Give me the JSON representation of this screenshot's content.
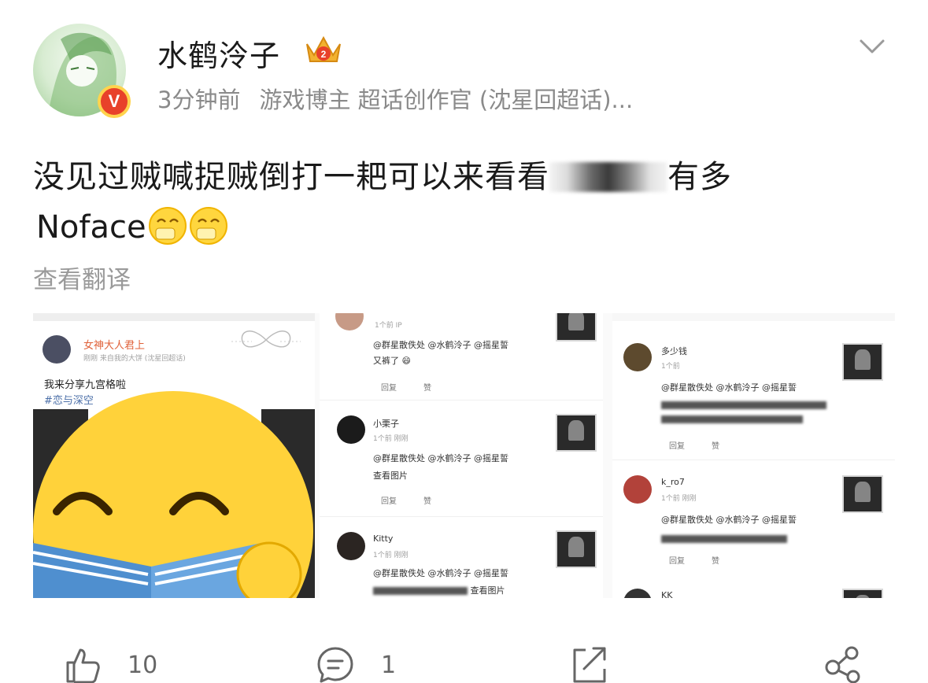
{
  "post": {
    "username": "水鹤泠子",
    "verified_badge": "V",
    "time": "3分钟前",
    "bio": "游戏博主 超话创作官 (沈星回超话)...",
    "text_line1_a": "没见过贼喊捉贼倒打一耙可以来看看",
    "text_line1_b": "有多",
    "text_line2": "Noface",
    "translate": "查看翻译"
  },
  "screenshots": {
    "pane1": {
      "name": "女神大人君上",
      "sub": "刚刚  来自我的大饼  (沈星回超话)",
      "line1": "我来分享九宫格啦",
      "line2": "#恋与深空"
    },
    "comments_mid": [
      {
        "meta": "1个前  IP",
        "text": "@群星散佚处 @水鹤泠子 @摇星誓",
        "extra": "又裤了"
      },
      {
        "user": "小栗子",
        "meta": "1个前  刚刚",
        "text": "@群星散佚处 @水鹤泠子 @摇星誓",
        "extra": "查看图片"
      },
      {
        "user": "Kitty",
        "meta": "1个前  刚刚",
        "text": "@群星散佚处 @水鹤泠子 @摇星誓",
        "extra": "查看图片"
      }
    ],
    "comments_right": [
      {
        "user": "多少钱",
        "meta": "1个前",
        "text": "@群星散佚处 @水鹤泠子 @摇星誓"
      },
      {
        "user": "k_ro7",
        "meta": "1个前  刚刚",
        "text": "@群星散佚处 @水鹤泠子 @摇星誓"
      },
      {
        "user": "KK",
        "meta": "",
        "text": ""
      }
    ],
    "reply_label": "回复",
    "like_label": "赞"
  },
  "actions": {
    "likes": "10",
    "comments": "1",
    "reposts": "",
    "share": ""
  },
  "icons": [
    "chevron-down-icon",
    "crown-badge-icon",
    "verified-icon",
    "smile-emoji-icon",
    "like-icon",
    "comment-icon",
    "repost-icon",
    "share-icon"
  ]
}
